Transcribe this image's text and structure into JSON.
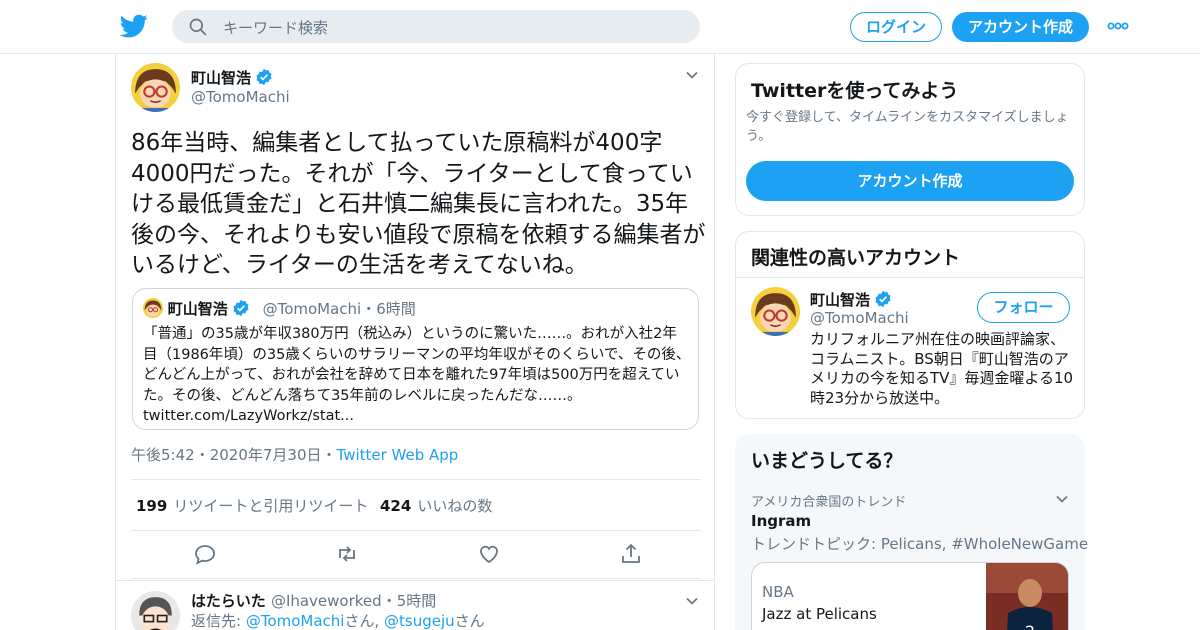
{
  "header": {
    "search_placeholder": "キーワード検索",
    "login_label": "ログイン",
    "signup_label": "アカウント作成",
    "brand_color": "#1da1f2"
  },
  "tweet": {
    "author_name": "町山智浩",
    "author_handle": "@TomoMachi",
    "text": "86年当時、編集者として払っていた原稿料が400字4000円だった。それが「今、ライターとして食っていける最低賃金だ」と石井慎二編集長に言われた。35年後の今、それよりも安い値段で原稿を依頼する編集者がいるけど、ライターの生活を考えてないね。",
    "quote": {
      "name": "町山智浩",
      "handle": "@TomoMachi",
      "time": "・6時間",
      "text": "「普通」の35歳が年収380万円（税込み）というのに驚いた……。おれが入社2年目（1986年頃）の35歳くらいのサラリーマンの平均年収がそのくらいで、その後、どんどん上がって、おれが会社を辞めて日本を離れた97年頃は500万円を超えていた。その後、どんどん落ちて35年前のレベルに戻ったんだな……。",
      "link": "twitter.com/LazyWorkz/stat..."
    },
    "time": "午後5:42",
    "date": "・2020年7月30日",
    "app_sep": "・",
    "app": "Twitter Web App",
    "retweets_count": "199",
    "retweets_label": "リツイートと引用リツイート",
    "likes_count": "424",
    "likes_label": "いいねの数"
  },
  "reply": {
    "name": "はたらいた",
    "handle": "@Ihaveworked",
    "time": "・5時間",
    "to_prefix": "返信先: ",
    "to_user1": "@TomoMachi",
    "to_suffix1": "さん, ",
    "to_user2": "@tsugeju",
    "to_suffix2": "さん"
  },
  "sidebar": {
    "try": {
      "title": "Twitterを使ってみよう",
      "subtitle": "今すぐ登録して、タイムラインをカスタマイズしましょう。",
      "button": "アカウント作成"
    },
    "related": {
      "title": "関連性の高いアカウント",
      "name": "町山智浩",
      "handle": "@TomoMachi",
      "follow_label": "フォロー",
      "bio": "カリフォルニア州在住の映画評論家、コラムニスト。BS朝日『町山智浩のアメリカの今を知るTV』毎週金曜よる10時23分から放送中。"
    },
    "trends": {
      "title": "いまどうしてる？",
      "location": "アメリカ合衆国のトレンド",
      "name": "Ingram",
      "desc": "トレンドトピック: Pelicans, #WholeNewGame",
      "news_category": "NBA",
      "news_headline": "Jazz at Pelicans"
    }
  }
}
